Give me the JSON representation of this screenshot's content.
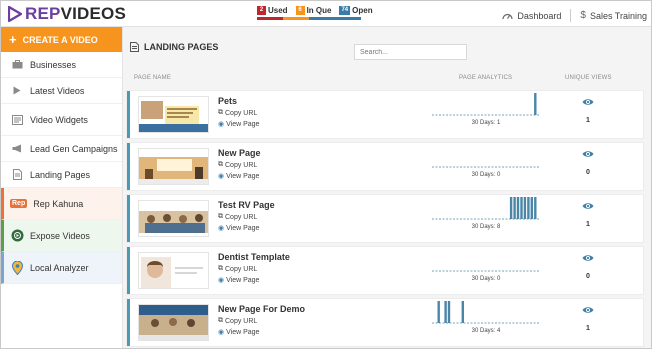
{
  "brand": {
    "rep": "REP",
    "videos": "VIDEOS"
  },
  "usage": {
    "used": {
      "count": "2",
      "label": "Used",
      "color": "#c0272d"
    },
    "in_que": {
      "count": "6",
      "label": "In Que",
      "color": "#f7941d"
    },
    "open": {
      "count": "74",
      "label": "Open",
      "color": "#3a7ca5"
    }
  },
  "topnav": {
    "dashboard": "Dashboard",
    "sales_training": "Sales Training"
  },
  "sidebar": {
    "create": "CREATE A VIDEO",
    "items": [
      {
        "label": "Businesses",
        "icon": "briefcase-icon"
      },
      {
        "label": "Latest Videos",
        "icon": "play-icon"
      },
      {
        "label": "Video Widgets",
        "icon": "widget-icon"
      },
      {
        "label": "Lead Gen Campaigns",
        "icon": "megaphone-icon"
      },
      {
        "label": "Landing Pages",
        "icon": "file-icon"
      }
    ],
    "rep_kahuna": {
      "badge": "Rep",
      "label": "Rep Kahuna"
    },
    "expose_videos": {
      "label": "Expose Videos"
    },
    "local_analyzer": {
      "label": "Local Analyzer"
    }
  },
  "page": {
    "title": "LANDING PAGES",
    "search_placeholder": "Search...",
    "columns": {
      "name": "PAGE NAME",
      "analytics": "PAGE ANALYTICS",
      "views": "UNIQUE VIEWS"
    },
    "copy_url": "Copy URL",
    "view_page": "View Page"
  },
  "rows": [
    {
      "name": "Pets",
      "days": "30 Days: 1",
      "views": "1",
      "bars": [
        29
      ]
    },
    {
      "name": "New Page",
      "days": "30 Days: 0",
      "views": "0",
      "bars": []
    },
    {
      "name": "Test RV Page",
      "days": "30 Days: 8",
      "views": "1",
      "bars": [
        22,
        23,
        24,
        25,
        26,
        27,
        28,
        29
      ]
    },
    {
      "name": "Dentist Template",
      "days": "30 Days: 0",
      "views": "0",
      "bars": []
    },
    {
      "name": "New Page For Demo",
      "days": "30 Days: 4",
      "views": "1",
      "bars": [
        1,
        3,
        4,
        8
      ]
    }
  ],
  "colors": {
    "accent": "#f7941d",
    "row_border": "#4a9ab5",
    "bar": "#4a86a8",
    "eye": "#3f7ea5",
    "brand_purple": "#6b3fa0"
  }
}
